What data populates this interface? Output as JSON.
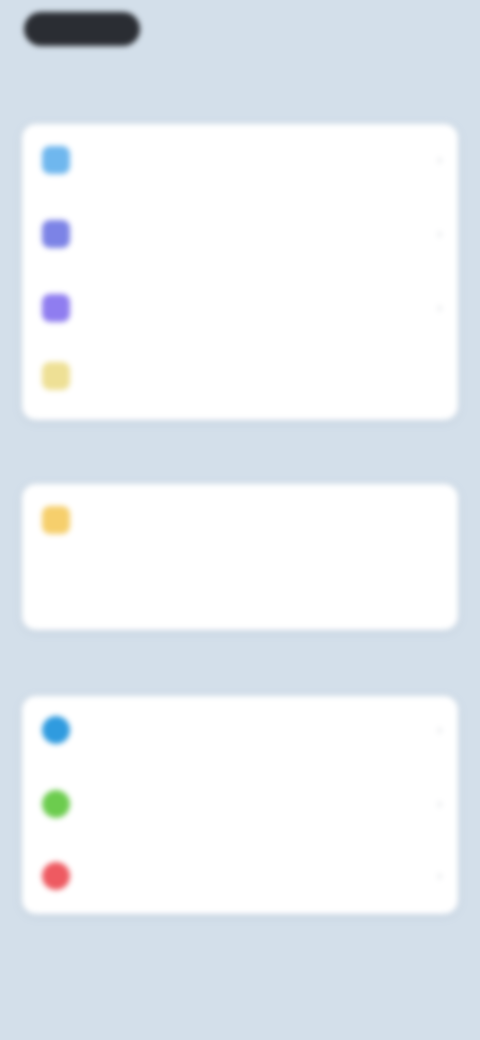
{
  "header": {
    "pill_label": ""
  },
  "sections": [
    {
      "title": "",
      "rows": [
        {
          "label": "",
          "icon": "wifi-icon",
          "color": "#6fb7ee"
        },
        {
          "label": "",
          "icon": "bluetooth-icon",
          "color": "#7c83e6"
        },
        {
          "label": "",
          "icon": "display-icon",
          "color": "#8f7df0"
        },
        {
          "label": "",
          "icon": "battery-icon",
          "color": "#eee095",
          "value": ""
        }
      ]
    },
    {
      "title": "",
      "rows": [
        {
          "label": "",
          "icon": "sun-icon",
          "color": "#f6cf6c",
          "value": ""
        }
      ],
      "caption": ""
    },
    {
      "title": "",
      "rows": [
        {
          "label": "",
          "icon": "globe-icon",
          "color": "#2f9bdf"
        },
        {
          "label": "",
          "icon": "leaf-icon",
          "color": "#6ccc4e"
        },
        {
          "label": "",
          "icon": "heart-icon",
          "color": "#ee5a61"
        }
      ]
    }
  ],
  "footer": {
    "text": ""
  }
}
